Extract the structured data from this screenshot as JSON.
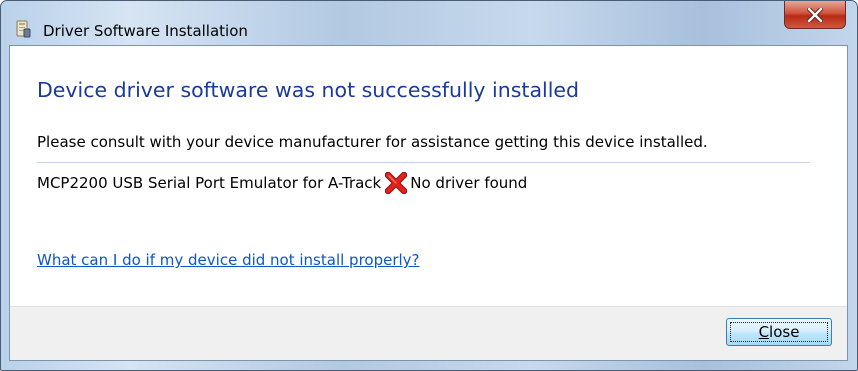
{
  "window": {
    "title": "Driver Software Installation",
    "title_icon": "driver-install-icon",
    "close_icon": "close-icon"
  },
  "main": {
    "heading": "Device driver software was not successfully installed",
    "message": "Please consult with your device manufacturer for assistance getting this device installed.",
    "device": {
      "name": "MCP2200 USB Serial Port Emulator for A-Track",
      "status_icon": "error-x-icon",
      "status": "No driver found"
    },
    "help_link": "What can I do if my device did not install properly?"
  },
  "footer": {
    "close_label": "Close"
  },
  "colors": {
    "heading": "#1a3b9a",
    "link": "#0d57c8",
    "error": "#d01818",
    "close_button_border": "#3c7fb1"
  }
}
